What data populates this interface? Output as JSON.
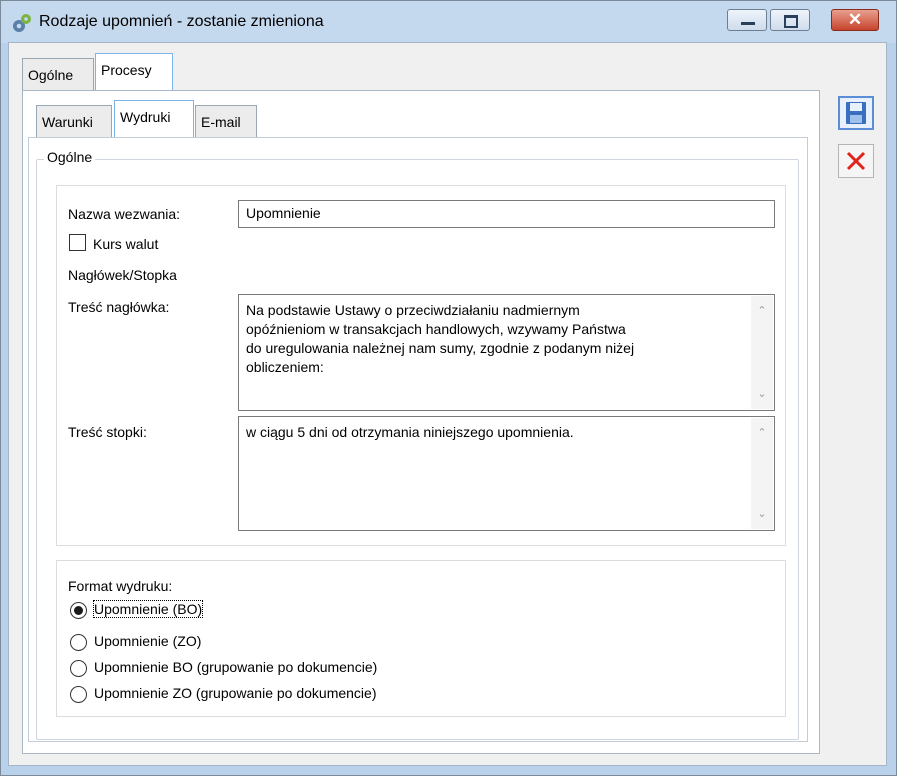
{
  "window": {
    "title": "Rodzaje upomnień - zostanie zmieniona",
    "minimize_icon": "minimize-icon",
    "maximize_icon": "maximize-icon",
    "close_symbol": "✕",
    "app_icon": "gears-icon"
  },
  "main_tabs": [
    {
      "label": "Ogólne",
      "active": false
    },
    {
      "label": "Procesy",
      "active": true
    }
  ],
  "sub_tabs": [
    {
      "label": "Warunki",
      "active": false
    },
    {
      "label": "Wydruki",
      "active": true
    },
    {
      "label": "E-mail",
      "active": false
    }
  ],
  "group": {
    "title": "Ogólne"
  },
  "form": {
    "name_label": "Nazwa wezwania:",
    "name_value": "Upomnienie",
    "currency_label": "Kurs walut",
    "currency_checked": false,
    "header_footer_label": "Nagłówek/Stopka",
    "header_label": "Treść nagłówka:",
    "header_text": "Na podstawie Ustawy o przeciwdziałaniu nadmiernym\nopóźnieniom w transakcjach handlowych, wzywamy Państwa\ndo uregulowania należnej nam sumy, zgodnie z podanym niżej\nobliczeniem:",
    "footer_label": "Treść stopki:",
    "footer_text": "w ciągu 5 dni od otrzymania niniejszego upomnienia."
  },
  "print_format": {
    "label": "Format wydruku:",
    "options": [
      {
        "label": "Upomnienie (BO)",
        "selected": true
      },
      {
        "label": "Upomnienie (ZO)",
        "selected": false
      },
      {
        "label": "Upomnienie BO (grupowanie po dokumencie)",
        "selected": false
      },
      {
        "label": "Upomnienie ZO (grupowanie po dokumencie)",
        "selected": false
      }
    ]
  },
  "toolbar": {
    "save_icon": "save-icon",
    "cancel_icon": "cancel-icon"
  },
  "colors": {
    "titlebar": "#c5d9ee",
    "accent_blue": "#5b8ed6",
    "close_red": "#c7432b",
    "cancel_red": "#e0241b"
  }
}
